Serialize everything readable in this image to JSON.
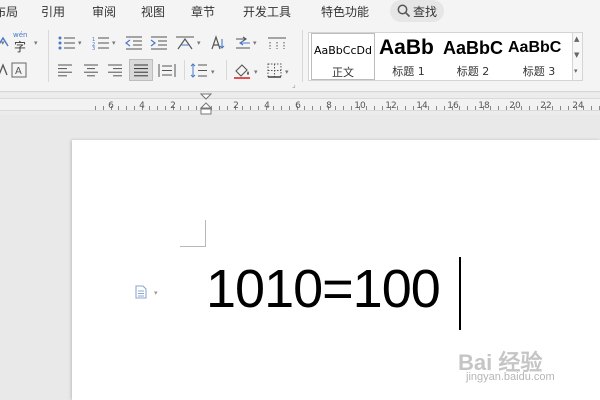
{
  "menu": {
    "tabs": [
      {
        "label": "布局"
      },
      {
        "label": "引用"
      },
      {
        "label": "审阅"
      },
      {
        "label": "视图"
      },
      {
        "label": "章节"
      },
      {
        "label": "开发工具"
      },
      {
        "label": "特色功能"
      }
    ],
    "search_label": "查找"
  },
  "ribbon": {
    "phonetic_guide_label": "wén",
    "phonetic_guide_char": "字",
    "styles": [
      {
        "preview": "AaBbCcDd",
        "name": "正文"
      },
      {
        "preview": "AaBb",
        "name": "标题 1"
      },
      {
        "preview": "AaBbC",
        "name": "标题 2"
      },
      {
        "preview": "AaBbC",
        "name": "标题 3"
      }
    ]
  },
  "ruler": {
    "labels": [
      "6",
      "4",
      "2",
      "2",
      "4",
      "6",
      "8",
      "10",
      "12",
      "14",
      "16",
      "18",
      "20",
      "22",
      "24"
    ]
  },
  "document": {
    "text": "1010=100"
  },
  "watermark": {
    "logo": "Bai 经验",
    "url": "jingyan.baidu.com"
  },
  "colors": {
    "accent_blue": "#4a78c8",
    "paint_red": "#e05050"
  }
}
